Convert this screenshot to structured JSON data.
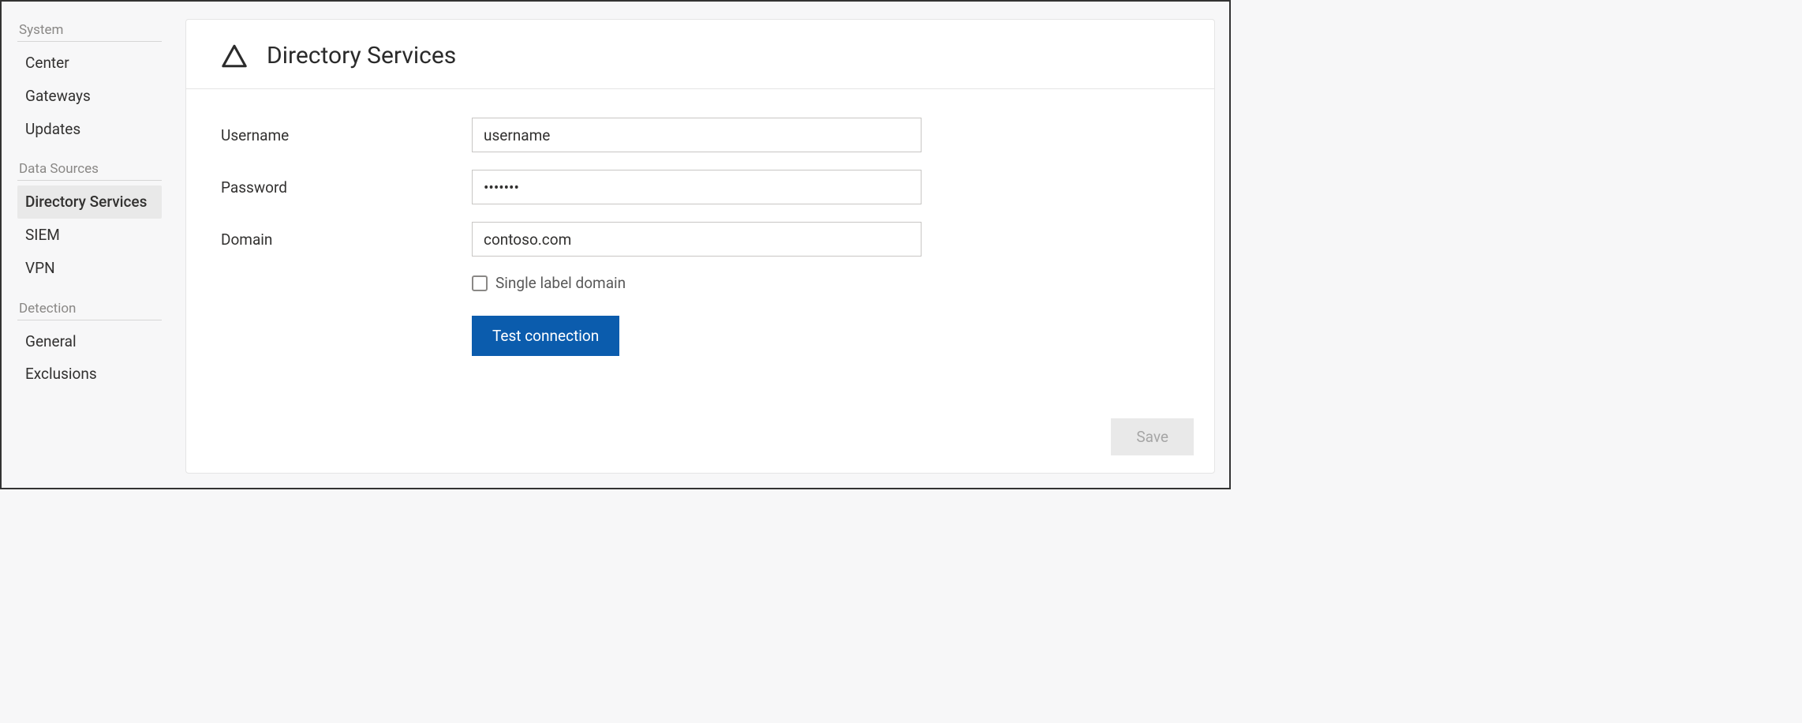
{
  "sidebar": {
    "sections": [
      {
        "title": "System",
        "items": [
          {
            "label": "Center",
            "selected": false
          },
          {
            "label": "Gateways",
            "selected": false
          },
          {
            "label": "Updates",
            "selected": false
          }
        ]
      },
      {
        "title": "Data Sources",
        "items": [
          {
            "label": "Directory Services",
            "selected": true
          },
          {
            "label": "SIEM",
            "selected": false
          },
          {
            "label": "VPN",
            "selected": false
          }
        ]
      },
      {
        "title": "Detection",
        "items": [
          {
            "label": "General",
            "selected": false
          },
          {
            "label": "Exclusions",
            "selected": false
          }
        ]
      }
    ]
  },
  "page": {
    "title": "Directory Services",
    "icon": "warning-triangle-icon"
  },
  "form": {
    "username": {
      "label": "Username",
      "value": "username"
    },
    "password": {
      "label": "Password",
      "value": "•••••••"
    },
    "domain": {
      "label": "Domain",
      "value": "contoso.com"
    },
    "single_label_domain": {
      "label": "Single label domain",
      "checked": false
    },
    "test_button": "Test connection",
    "save_button": "Save"
  }
}
